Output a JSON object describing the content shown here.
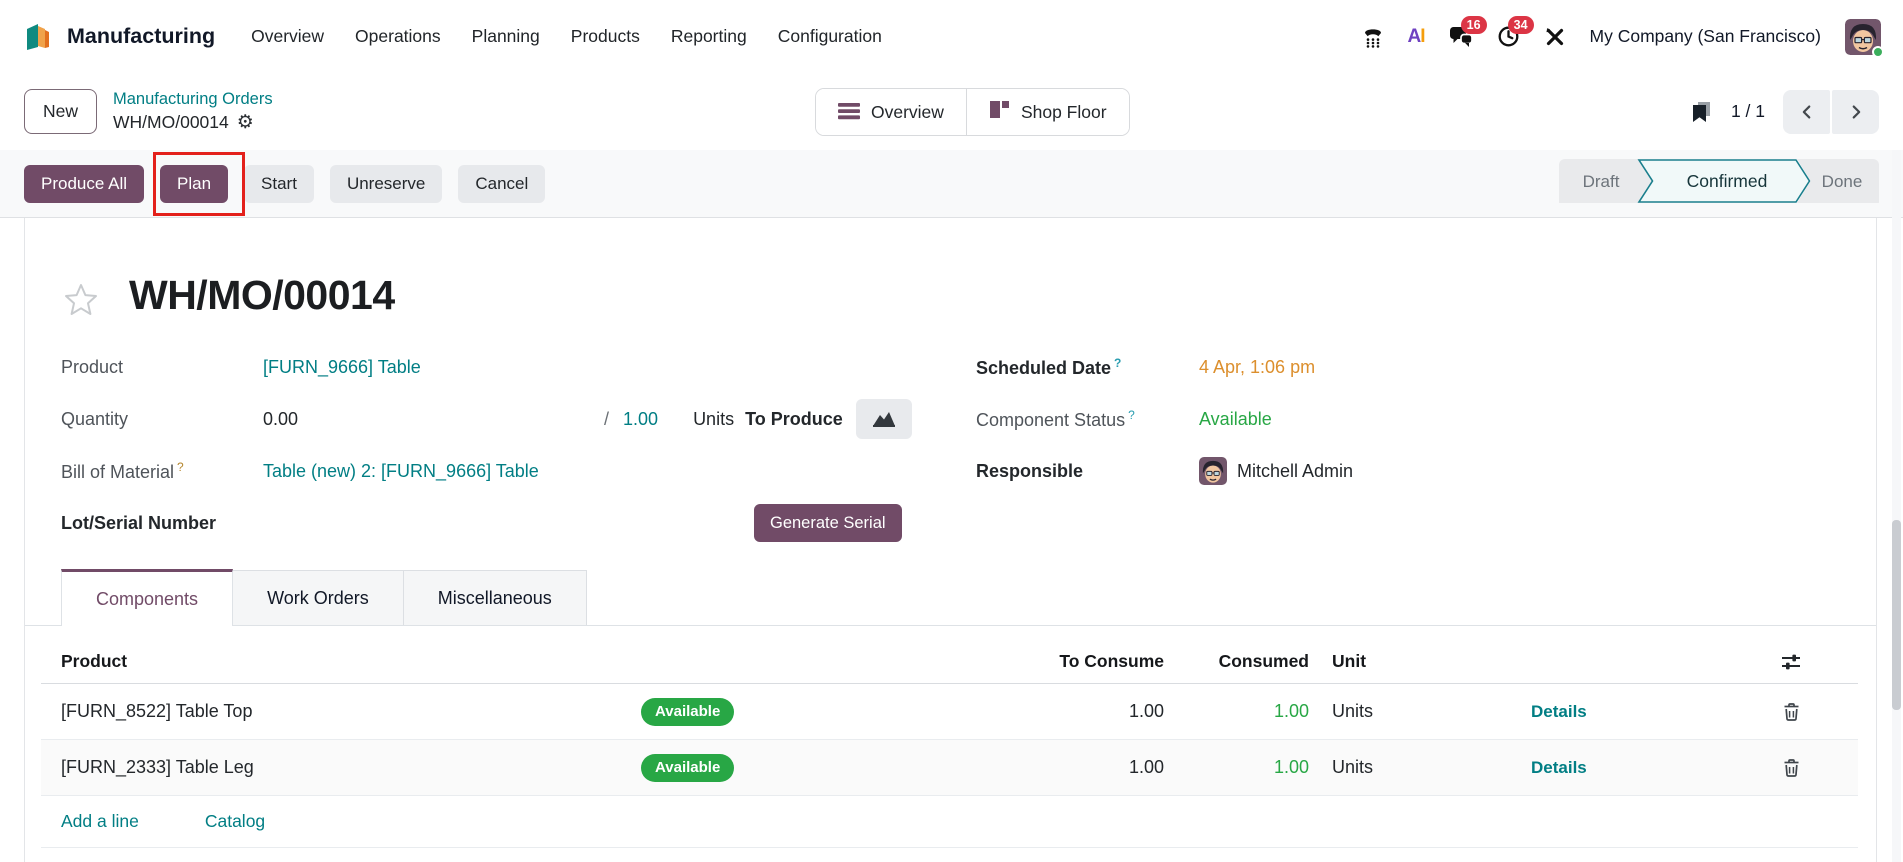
{
  "topbar": {
    "app_name": "Manufacturing",
    "menu": {
      "overview": "Overview",
      "operations": "Operations",
      "planning": "Planning",
      "products": "Products",
      "reporting": "Reporting",
      "configuration": "Configuration"
    },
    "messages_badge": "16",
    "activities_badge": "34",
    "ai_a": "A",
    "ai_i": "I",
    "company": "My Company (San Francisco)"
  },
  "breadcrumb": {
    "new_button": "New",
    "parent": "Manufacturing Orders",
    "current": "WH/MO/00014"
  },
  "view_switch": {
    "overview": "Overview",
    "shop_floor": "Shop Floor"
  },
  "pager": {
    "counter": "1 / 1"
  },
  "actions": {
    "produce_all": "Produce All",
    "plan": "Plan",
    "start": "Start",
    "unreserve": "Unreserve",
    "cancel": "Cancel"
  },
  "statusbar": {
    "draft": "Draft",
    "confirmed": "Confirmed",
    "done": "Done",
    "active": "Confirmed"
  },
  "record": {
    "title": "WH/MO/00014",
    "product_label": "Product",
    "product_value": "[FURN_9666] Table",
    "quantity_label": "Quantity",
    "quantity_value": "0.00",
    "quantity_sep": "/",
    "quantity_total": "1.00",
    "quantity_unit": "Units",
    "to_produce_label": "To Produce",
    "bom_label": "Bill of Material",
    "bom_value": "Table (new) 2: [FURN_9666] Table",
    "lot_label": "Lot/Serial Number",
    "generate_serial": "Generate Serial",
    "scheduled_label": "Scheduled Date",
    "scheduled_value": "4 Apr, 1:06 pm",
    "component_status_label": "Component Status",
    "component_status_value": "Available",
    "responsible_label": "Responsible",
    "responsible_value": "Mitchell Admin"
  },
  "misc": {
    "help": "?"
  },
  "tabs": [
    {
      "label": "Components",
      "active": true
    },
    {
      "label": "Work Orders",
      "active": false
    },
    {
      "label": "Miscellaneous",
      "active": false
    }
  ],
  "components_table": {
    "headers": {
      "product": "Product",
      "to_consume": "To Consume",
      "consumed": "Consumed",
      "unit": "Unit"
    },
    "rows": [
      {
        "product": "[FURN_8522] Table Top",
        "status": "Available",
        "to_consume": "1.00",
        "consumed": "1.00",
        "unit": "Units",
        "details": "Details"
      },
      {
        "product": "[FURN_2333] Table Leg",
        "status": "Available",
        "to_consume": "1.00",
        "consumed": "1.00",
        "unit": "Units",
        "details": "Details"
      }
    ],
    "footer": {
      "add_line": "Add a line",
      "catalog": "Catalog"
    }
  },
  "icons": {
    "app-icon": "teal-orange book",
    "phone-icon": "voip handset",
    "ai-icon": "AI letters",
    "messages-icon": "chat bubbles",
    "activities-icon": "clock",
    "tools-icon": "crossed tools",
    "gear-icon": "⚙",
    "hamburger-icon": "three bars",
    "kanban-icon": "shop floor blocks",
    "bookmark-icon": "bookmark",
    "chevron-left-icon": "‹",
    "chevron-right-icon": "›",
    "star-icon": "favorite star outline",
    "chart-icon": "forecast area chart",
    "optional-columns-icon": "sliders",
    "trash-icon": "delete bin"
  },
  "colors": {
    "primary_purple": "#714b67",
    "link_teal": "#017e84",
    "status_green": "#28a745",
    "scheduled_orange": "#dc8f2d",
    "badge_red": "#dc3545",
    "highlight_red": "#e3201b",
    "statusbar_teal": "#1a7f8d"
  }
}
